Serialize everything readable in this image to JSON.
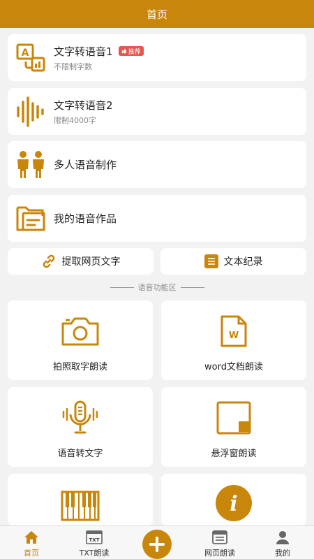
{
  "header": {
    "title": "首页"
  },
  "features": [
    {
      "title": "文字转语音1",
      "subtitle": "不限制字数",
      "badge": "推荐",
      "icon": "text-to-speech-icon"
    },
    {
      "title": "文字转语音2",
      "subtitle": "限制4000字",
      "icon": "sound-wave-icon"
    },
    {
      "title": "多人语音制作",
      "icon": "people-icon"
    },
    {
      "title": "我的语音作品",
      "icon": "folder-icon"
    }
  ],
  "quick": {
    "extract_web_text": "提取网页文字",
    "text_records": "文本纪录"
  },
  "section_title": "语音功能区",
  "grid": [
    {
      "label": "拍照取字朗读",
      "icon": "camera-icon"
    },
    {
      "label": "word文档朗读",
      "icon": "word-doc-icon",
      "icon_text": "W"
    },
    {
      "label": "语音转文字",
      "icon": "microphone-icon"
    },
    {
      "label": "悬浮窗朗读",
      "icon": "floating-window-icon"
    },
    {
      "label": "",
      "icon": "piano-icon"
    },
    {
      "label": "",
      "icon": "info-icon",
      "icon_text": "i"
    }
  ],
  "tabs": [
    {
      "label": "首页",
      "icon": "home-icon",
      "active": true
    },
    {
      "label": "TXT朗读",
      "icon": "txt-icon",
      "icon_text": "TXT"
    },
    {
      "label": "",
      "icon": "plus-icon"
    },
    {
      "label": "网页朗读",
      "icon": "browser-icon"
    },
    {
      "label": "我的",
      "icon": "user-icon"
    }
  ],
  "colors": {
    "accent": "#c8860b",
    "badge": "#e8574f",
    "background": "#f2f2f2"
  }
}
